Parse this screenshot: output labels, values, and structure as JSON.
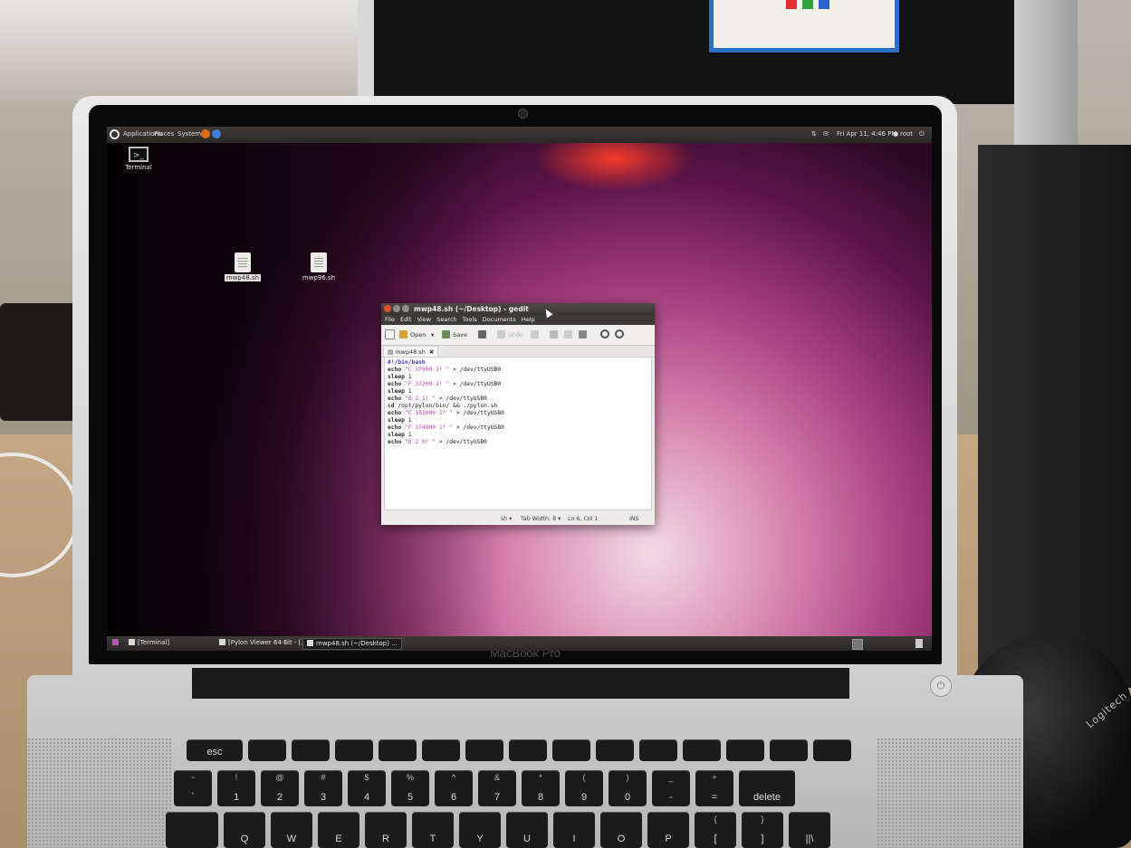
{
  "laptop": {
    "brand": "MacBook Pro",
    "power_symbol": "⏻"
  },
  "top_panel": {
    "menus": [
      "Applications",
      "Places",
      "System"
    ],
    "datetime": "Fri Apr 11,  4:46 PM",
    "user": "root"
  },
  "desktop_icons": [
    {
      "label": "Terminal",
      "icon": "terminal-icon"
    },
    {
      "label": "mwp48.sh",
      "icon": "shell-script-file-icon",
      "selected": true
    },
    {
      "label": "mwp96.sh",
      "icon": "shell-script-file-icon",
      "selected": false
    }
  ],
  "gedit": {
    "title": "mwp48.sh (~/Desktop) - gedit",
    "menu": [
      "File",
      "Edit",
      "View",
      "Search",
      "Tools",
      "Documents",
      "Help"
    ],
    "toolbar": {
      "open": "Open",
      "save": "Save",
      "undo": "Undo"
    },
    "tab": "mwp48.sh",
    "lines": [
      {
        "parts": [
          {
            "t": "#!/bin/bash",
            "c": "shebang"
          }
        ]
      },
      {
        "parts": [
          {
            "t": "echo ",
            "c": "kw"
          },
          {
            "t": "\"C 37500 2! \"",
            "c": "str"
          },
          {
            "t": " > /dev/ttyUSB0",
            "c": ""
          }
        ]
      },
      {
        "parts": [
          {
            "t": "sleep ",
            "c": "kw"
          },
          {
            "t": "1",
            "c": ""
          }
        ]
      },
      {
        "parts": [
          {
            "t": "echo ",
            "c": "kw"
          },
          {
            "t": "\"F 37200 2! \"",
            "c": "str"
          },
          {
            "t": " > /dev/ttyUSB0",
            "c": ""
          }
        ]
      },
      {
        "parts": [
          {
            "t": "sleep ",
            "c": "kw"
          },
          {
            "t": "1",
            "c": ""
          }
        ]
      },
      {
        "parts": [
          {
            "t": "echo ",
            "c": "kw"
          },
          {
            "t": "\"Q 2 1! \"",
            "c": "str"
          },
          {
            "t": " > /dev/ttyUSB0",
            "c": ""
          }
        ]
      },
      {
        "parts": [
          {
            "t": "cd ",
            "c": "kw"
          },
          {
            "t": "/opt/pylon/bin/ && ./pylon.sh",
            "c": ""
          }
        ]
      },
      {
        "parts": [
          {
            "t": "echo ",
            "c": "kw"
          },
          {
            "t": "\"C 161000 1! \"",
            "c": "str"
          },
          {
            "t": " > /dev/ttyUSB0",
            "c": ""
          }
        ]
      },
      {
        "parts": [
          {
            "t": "sleep ",
            "c": "kw"
          },
          {
            "t": "1",
            "c": ""
          }
        ]
      },
      {
        "parts": [
          {
            "t": "echo ",
            "c": "kw"
          },
          {
            "t": "\"F 374800 1! \"",
            "c": "str"
          },
          {
            "t": " > /dev/ttyUSB0",
            "c": ""
          }
        ]
      },
      {
        "parts": [
          {
            "t": "sleep ",
            "c": "kw"
          },
          {
            "t": "1",
            "c": ""
          }
        ]
      },
      {
        "parts": [
          {
            "t": "echo ",
            "c": "kw"
          },
          {
            "t": "\"Q 2 0! \"",
            "c": "str"
          },
          {
            "t": " > /dev/ttyUSB0",
            "c": ""
          }
        ]
      }
    ],
    "status": {
      "language": "sh ▾",
      "tab_width": "Tab Width:  8 ▾",
      "position": "Ln 6, Col 1",
      "mode": "INS"
    }
  },
  "taskbar": [
    {
      "label": "[Terminal]",
      "active": false
    },
    {
      "label": "[Pylon Viewer 64-Bit - [...",
      "active": false
    },
    {
      "label": "mwp48.sh (~/Desktop) ...",
      "active": true
    }
  ],
  "keyboard": {
    "rows": [
      [
        "esc",
        "",
        "",
        "",
        "",
        "",
        "",
        "",
        "",
        "",
        "",
        "",
        "",
        "",
        ""
      ],
      [
        "~|`",
        "!|1",
        "@|2",
        "#|3",
        "$|4",
        "%|5",
        "^|6",
        "&|7",
        "*|8",
        "(|9",
        ")|0",
        "_|-",
        "+|=",
        "delete"
      ],
      [
        "",
        "Q",
        "W",
        "E",
        "R",
        "T",
        "Y",
        "U",
        "I",
        "O",
        "P",
        "{|[",
        "}|]",
        "||\\"
      ]
    ]
  }
}
